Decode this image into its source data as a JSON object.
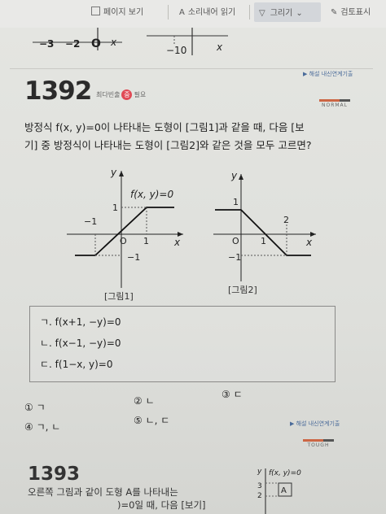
{
  "toolbar": {
    "page_view": "페이지 보기",
    "read_aloud": "소리내어 읽기",
    "draw": "그리기",
    "extra": "검토표시"
  },
  "top_graph": {
    "left_labels": [
      "−3",
      "−2",
      "O",
      "x"
    ],
    "right_labels": [
      "−10",
      "x"
    ]
  },
  "problem1": {
    "number": "1392",
    "badge_prefix": "최다빈출",
    "badge_mark": "중",
    "badge_suffix": "필요",
    "tag": "▶ 해설 내신연계기출",
    "level": "NORMAL",
    "question_line1": "방정식 f(x, y)=0이 나타내는 도형이 [그림1]과 같을 때, 다음 [보",
    "question_line2": "기] 중 방정식이 나타내는 도형이 [그림2]와 같은 것을 모두 고르면?",
    "figure1": {
      "caption": "[그림1]",
      "curve_label": "f(x, y)=0",
      "y_axis": "y",
      "x_axis": "x",
      "origin": "O",
      "labels": [
        "1",
        "−1",
        "1",
        "−1"
      ]
    },
    "figure2": {
      "caption": "[그림2]",
      "y_axis": "y",
      "x_axis": "x",
      "origin": "O",
      "labels": [
        "1",
        "1",
        "2",
        "−1"
      ]
    },
    "options": [
      "ㄱ. f(x+1, −y)=0",
      "ㄴ. f(x−1, −y)=0",
      "ㄷ. f(1−x, y)=0"
    ],
    "choices": [
      "① ㄱ",
      "② ㄴ",
      "③ ㄷ",
      "④ ㄱ, ㄴ",
      "⑤ ㄴ, ㄷ"
    ],
    "tag2": "▶ 해설 내신연계기출",
    "level2": "TOUGH"
  },
  "problem2": {
    "number": "1393",
    "line1": "오른쪽 그림과 같이 도형 A를 나타내는",
    "line2": ")=0일 때, 다음 [보기]",
    "mini_label": "f(x, y)=0",
    "mini_box": "A",
    "mini_y": "y",
    "mini_ticks": [
      "3",
      "2"
    ]
  }
}
